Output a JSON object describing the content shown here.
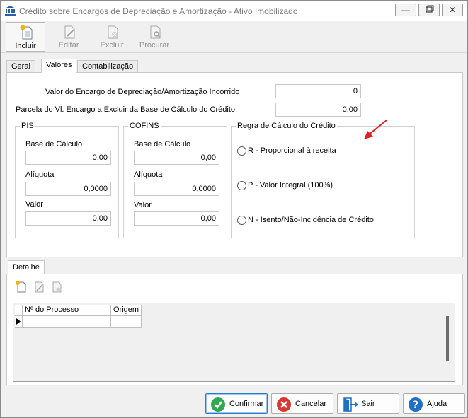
{
  "window": {
    "title": "Crédito sobre Encargos de Depreciação e Amortização - Ativo Imobilizado"
  },
  "toolbar": {
    "incluir": "Incluir",
    "editar": "Editar",
    "excluir": "Excluir",
    "procurar": "Procurar"
  },
  "tabs": [
    "Geral",
    "Valores",
    "Contabilização"
  ],
  "valores": {
    "valor_encargo_label": "Valor do Encargo de Depreciação/Amortização Incorrido",
    "valor_encargo_value": "0",
    "parcela_label": "Parcela do Vl. Encargo a Excluir da Base de Cálculo do Crédito",
    "parcela_value": "0,00",
    "pis": {
      "title": "PIS",
      "base_label": "Base de Cálculo",
      "base_value": "0,00",
      "aliquota_label": "Alíquota",
      "aliquota_value": "0,0000",
      "valor_label": "Valor",
      "valor_value": "0,00"
    },
    "cofins": {
      "title": "COFINS",
      "base_label": "Base de Cálculo",
      "base_value": "0,00",
      "aliquota_label": "Alíquota",
      "aliquota_value": "0,0000",
      "valor_label": "Valor",
      "valor_value": "0,00"
    },
    "regra": {
      "title": "Regra de Cálculo do Crédito",
      "options": [
        "R - Proporcional à receita",
        "P - Valor Integral (100%)",
        "N - Isento/Não-Incidência de Crédito"
      ]
    }
  },
  "detalhe": {
    "tab": "Detalhe",
    "columns": [
      "Nº do Processo",
      "Origem"
    ]
  },
  "buttons": {
    "confirmar": "Confirmar",
    "cancelar": "Cancelar",
    "sair": "Sair",
    "ajuda": "Ajuda"
  },
  "colors": {
    "arrow": "#e02020",
    "confirm": "#2fa84f",
    "cancel": "#d9382e",
    "help": "#1f6fc4"
  }
}
